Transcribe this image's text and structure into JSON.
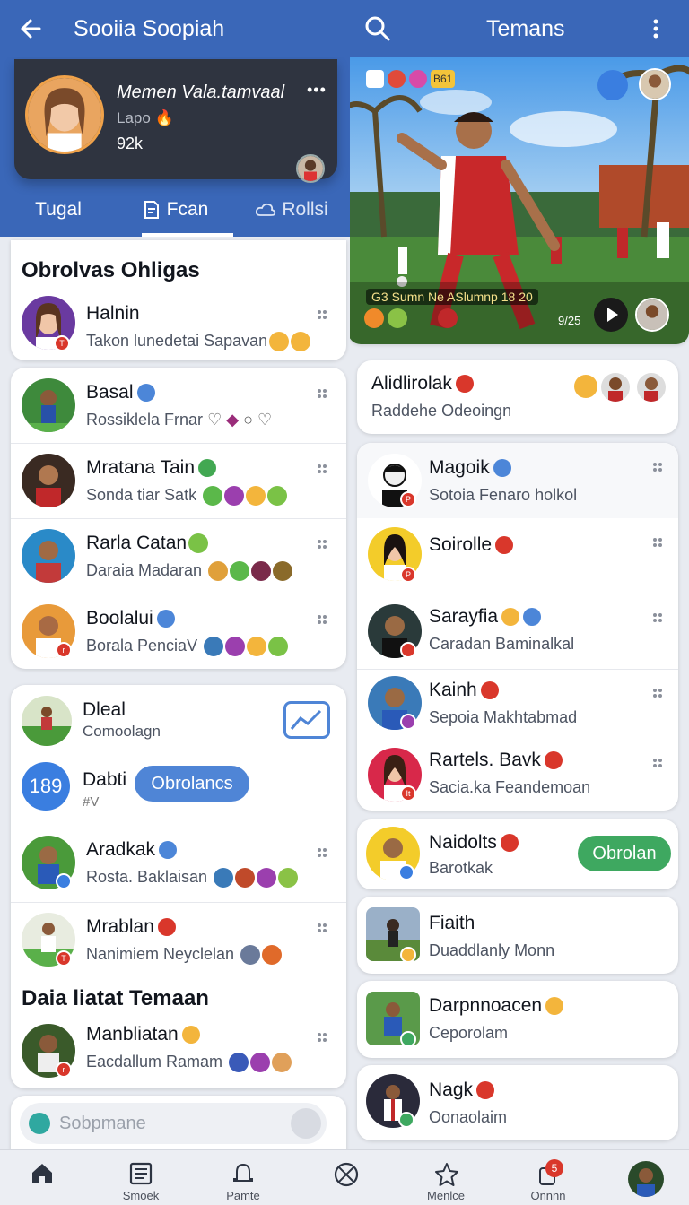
{
  "topbar": {
    "title_left": "Sooiia Soopiah",
    "title_right": "Temans"
  },
  "profile": {
    "name": "Memen Vala.tamvaal",
    "status": "Lapo",
    "followers": "92k"
  },
  "tabs": [
    {
      "label": "Tugal"
    },
    {
      "label": "Fcan"
    },
    {
      "label": "Rollsi"
    }
  ],
  "left": {
    "section1_title": "Obrolvas Ohligas",
    "pinned": {
      "name": "Halnin",
      "message": "Takon lunedetai Sapavan"
    },
    "list": [
      {
        "name": "Basal",
        "message": "Rossiklela Frnar"
      },
      {
        "name": "Mratana Tain",
        "message": "Sonda  tiar Satk"
      },
      {
        "name": "Rarla Catan",
        "message": "Daraia Madaran"
      },
      {
        "name": "Boolalui",
        "message": "Borala PenciaV"
      }
    ],
    "group": {
      "dleal": {
        "name": "Dleal",
        "message": "Comoolagn"
      },
      "dabti": {
        "count": "189",
        "name": "Dabti",
        "sub": "#V",
        "button": "Obrolancs"
      },
      "rows": [
        {
          "name": "Aradkak",
          "message": "Rosta. Baklaisan"
        },
        {
          "name": "Mrablan",
          "message": "Nanimiem Neyclelan"
        }
      ],
      "section2_title": "Daia liatat Temaan",
      "last": {
        "name": "Manbliatan",
        "message": "Eacdallum Ramam"
      }
    },
    "composer": {
      "placeholder": "Sobpmane"
    }
  },
  "video": {
    "caption": "G3 Sumn Ne ASlumnp 18 20",
    "time": "9/25",
    "top_badge": "B61"
  },
  "right": {
    "header_card": {
      "name": "Alidlirolak",
      "message": "Raddehe Odeoingn"
    },
    "list": [
      {
        "name": "Magoik",
        "message": "Sotoia Fenaro holkol"
      },
      {
        "name": "Soirolle",
        "message": ""
      },
      {
        "name": "Sarayfia",
        "message": "Caradan Baminalkal"
      },
      {
        "name": "Kainh",
        "message": "Sepoia Makhtabmad"
      },
      {
        "name": "Rartels. Bavk",
        "message": "Sacia.ka Feandemoan"
      }
    ],
    "naidolts": {
      "name": "Naidolts",
      "message": "Barotkak",
      "button": "Obrolan"
    },
    "fiaith": {
      "name": "Fiaith",
      "message": "Duaddlanly Monn"
    },
    "darp": {
      "name": "Darpnnoacen",
      "message": "Ceporolam"
    },
    "nagk": {
      "name": "Nagk",
      "message": "Oonaolaim"
    }
  },
  "bottomnav": [
    {
      "label": "",
      "icon": "home-icon"
    },
    {
      "label": "Smoek",
      "icon": "news-icon"
    },
    {
      "label": "Pamte",
      "icon": "bell-icon"
    },
    {
      "label": "",
      "icon": "ball-icon"
    },
    {
      "label": "Menlce",
      "icon": "star-icon"
    },
    {
      "label": "Onnnn",
      "icon": "notification-icon",
      "badge": "5"
    },
    {
      "label": "",
      "icon": "avatar"
    }
  ],
  "colors": {
    "brand": "#3a67b8",
    "green": "#3ea860",
    "pill_blue": "#4f85d6",
    "red_badge": "#d9372b"
  }
}
